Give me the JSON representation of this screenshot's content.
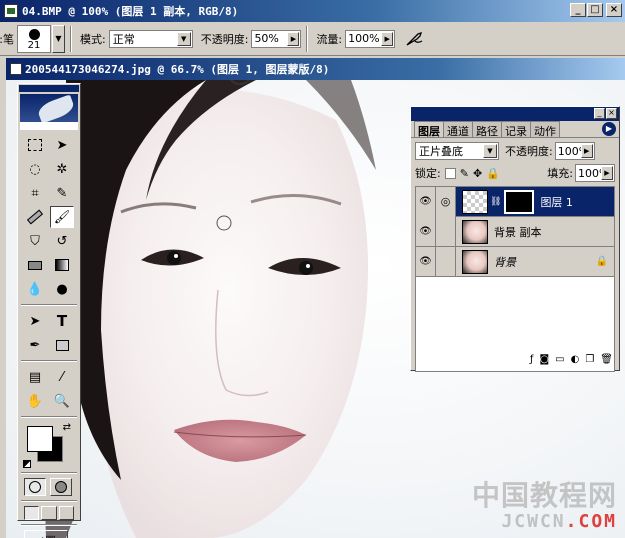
{
  "app": {
    "title": "04.BMP @ 100% (图层 1 副本, RGB/8)",
    "window_buttons": [
      "_",
      "□",
      "×"
    ]
  },
  "options_bar": {
    "brush_label": "笔:",
    "brush_size": "21",
    "mode_label": "模式:",
    "mode_value": "正常",
    "opacity_label": "不透明度:",
    "opacity_value": "50%",
    "flow_label": "流量:",
    "flow_value": "100%"
  },
  "document": {
    "title": "20054417304627​4.jpg @ 66.7% (图层 1, 图层蒙版/8)"
  },
  "layers_panel": {
    "tabs": [
      "图层",
      "通道",
      "路径",
      "记录",
      "动作"
    ],
    "active_tab": "图层",
    "blend_mode": "正片叠底",
    "opacity_label": "不透明度:",
    "opacity_value": "100%",
    "lock_label": "锁定:",
    "fill_label": "填充:",
    "fill_value": "100%",
    "layers": [
      {
        "name": "图层 1",
        "selected": true,
        "has_mask": true
      },
      {
        "name": "背景 副本",
        "selected": false,
        "has_mask": false
      },
      {
        "name": "背景",
        "selected": false,
        "has_mask": false,
        "locked": true
      }
    ]
  },
  "watermark": {
    "cn": "中国教程网",
    "en_main": "JCWCN",
    "en_dot": ".COM"
  }
}
